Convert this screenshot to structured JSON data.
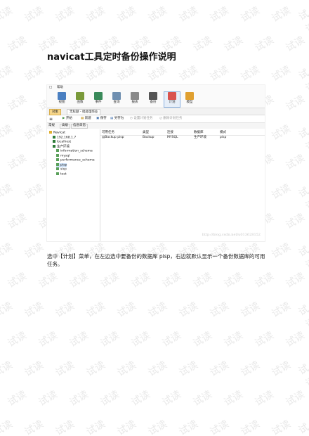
{
  "document": {
    "title": "navicat工具定时备份操作说明",
    "paragraph": "选中【计划】菜单，在左边选中要备份的数据库 pisp，右边就默认显示一个备份数据库的可用任务。"
  },
  "watermark": {
    "text": "试读",
    "color": "#e9e9e9"
  },
  "screenshot": {
    "menu": [
      "帮助"
    ],
    "toolbar": [
      {
        "label": "视图",
        "icon": "glasses-icon",
        "color": "#4a7fc1"
      },
      {
        "label": "函数",
        "icon": "function-icon",
        "color": "#7a9a3a"
      },
      {
        "label": "事件",
        "icon": "event-icon",
        "color": "#3a8a5a"
      },
      {
        "label": "查询",
        "icon": "query-icon",
        "color": "#6f8fb0"
      },
      {
        "label": "报表",
        "icon": "report-icon",
        "color": "#8a8a8a"
      },
      {
        "label": "备份",
        "icon": "backup-icon",
        "color": "#555555"
      },
      {
        "label": "计划",
        "icon": "calendar-icon",
        "color": "#d9534f",
        "active": true
      },
      {
        "label": "模型",
        "icon": "model-icon",
        "color": "#e0a030"
      }
    ],
    "tabs": [
      "对象",
      "无标题 - 批处理作业"
    ],
    "actions": [
      "开始",
      "新建",
      "保存",
      "另存为",
      "设置计划任务",
      "删除计划任务"
    ],
    "subtabs": [
      "常规",
      "高级",
      "信息日志"
    ],
    "tree": [
      {
        "label": "Navicat",
        "level": 0
      },
      {
        "label": "192.168.1.7",
        "level": 1
      },
      {
        "label": "localhost",
        "level": 1
      },
      {
        "label": "生产环境",
        "level": 1
      },
      {
        "label": "information_schema",
        "level": 2
      },
      {
        "label": "mysql",
        "level": 2
      },
      {
        "label": "performance_schema",
        "level": 2
      },
      {
        "label": "pisp",
        "level": 2,
        "selected": true
      },
      {
        "label": "sisp",
        "level": 2
      },
      {
        "label": "test",
        "level": 2
      }
    ],
    "columns": [
      "可用任务",
      "类型",
      "连接",
      "数据库",
      "模式"
    ],
    "rows": [
      [
        "Backup pisp",
        "Backup",
        "MYSQL",
        "生产环境",
        "pisp"
      ]
    ],
    "url": "http://blog.csdn.net/u013628152"
  }
}
